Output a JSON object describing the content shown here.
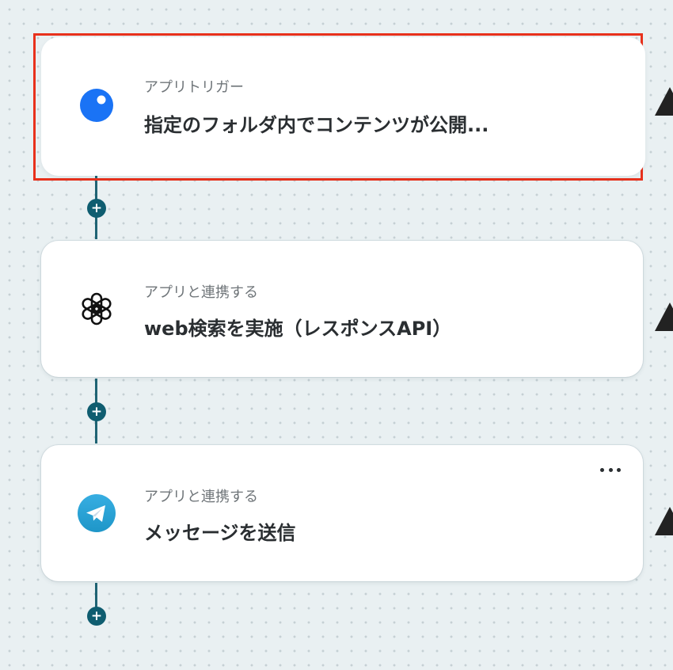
{
  "steps": [
    {
      "type": "アプリトリガー",
      "title": "指定のフォルダ内でコンテンツが公開...",
      "icon": "app-trigger-icon",
      "icon_color": "#1a73f5",
      "selected": true
    },
    {
      "type": "アプリと連携する",
      "title": "web検索を実施（レスポンスAPI）",
      "icon": "openai-icon",
      "selected": false
    },
    {
      "type": "アプリと連携する",
      "title": "メッセージを送信",
      "icon": "telegram-icon",
      "icon_color": "#2aa3e0",
      "selected": false
    }
  ],
  "add_step_symbol": "+",
  "colors": {
    "connector": "#1f6474",
    "selection_outline": "#e8311c",
    "background": "#e9f0f2"
  }
}
